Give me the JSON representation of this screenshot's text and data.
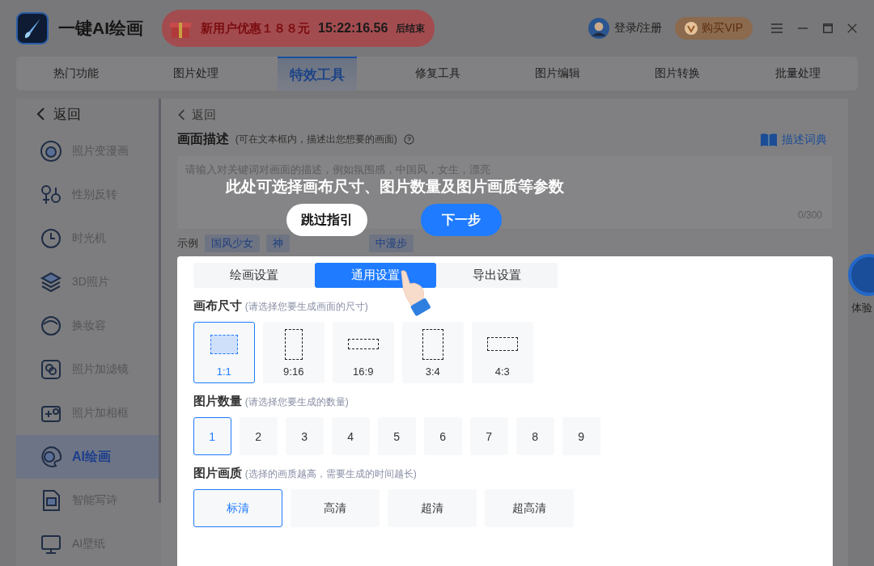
{
  "app": {
    "title": "一键AI绘画"
  },
  "promo": {
    "text": "新用户优惠１８８元",
    "countdown": "15:22:16.56",
    "suffix": "后结束"
  },
  "account": {
    "login": "登录/注册",
    "vip": "购买VIP"
  },
  "nav_tabs": [
    {
      "label": "热门功能",
      "selected": false
    },
    {
      "label": "图片处理",
      "selected": false
    },
    {
      "label": "特效工具",
      "selected": true
    },
    {
      "label": "修复工具",
      "selected": false
    },
    {
      "label": "图片编辑",
      "selected": false
    },
    {
      "label": "图片转换",
      "selected": false
    },
    {
      "label": "批量处理",
      "selected": false
    }
  ],
  "sidebar": {
    "back": "返回",
    "items": [
      {
        "label": "照片变漫画",
        "selected": false
      },
      {
        "label": "性别反转",
        "selected": false
      },
      {
        "label": "时光机",
        "selected": false
      },
      {
        "label": "3D照片",
        "selected": false
      },
      {
        "label": "换妆容",
        "selected": false
      },
      {
        "label": "照片加滤镜",
        "selected": false
      },
      {
        "label": "照片加相框",
        "selected": false
      },
      {
        "label": "AI绘画",
        "selected": true
      },
      {
        "label": "智能写诗",
        "selected": false
      },
      {
        "label": "AI壁纸",
        "selected": false
      }
    ]
  },
  "main": {
    "back": "返回",
    "description": {
      "title": "画面描述",
      "hint": "(可在文本框内，描述出您想要的画面)",
      "dictionary": "描述词典",
      "placeholder": "请输入对关键词对画面的描述，例如氛围感，中国风，女生，漂亮",
      "counter": "0/300"
    },
    "examples": {
      "label": "示例",
      "tags": [
        "国风少女",
        "神",
        "中漫步"
      ]
    }
  },
  "guide": {
    "message": "此处可选择画布尺寸、图片数量及图片画质等参数",
    "skip": "跳过指引",
    "next": "下一步"
  },
  "settings": {
    "tabs": [
      {
        "label": "绘画设置",
        "selected": false
      },
      {
        "label": "通用设置",
        "selected": true
      },
      {
        "label": "导出设置",
        "selected": false
      }
    ],
    "canvas_size": {
      "title": "画布尺寸",
      "hint": "(请选择您要生成画面的尺寸)",
      "options": [
        {
          "label": "1:1",
          "selected": true
        },
        {
          "label": "9:16",
          "selected": false
        },
        {
          "label": "16:9",
          "selected": false
        },
        {
          "label": "3:4",
          "selected": false
        },
        {
          "label": "4:3",
          "selected": false
        }
      ]
    },
    "count": {
      "title": "图片数量",
      "hint": "(请选择您要生成的数量)",
      "options": [
        {
          "label": "1",
          "selected": true
        },
        {
          "label": "2",
          "selected": false
        },
        {
          "label": "3",
          "selected": false
        },
        {
          "label": "4",
          "selected": false
        },
        {
          "label": "5",
          "selected": false
        },
        {
          "label": "6",
          "selected": false
        },
        {
          "label": "7",
          "selected": false
        },
        {
          "label": "8",
          "selected": false
        },
        {
          "label": "9",
          "selected": false
        }
      ]
    },
    "quality": {
      "title": "图片画质",
      "hint": "(选择的画质越高，需要生成的时间越长)",
      "options": [
        {
          "label": "标清",
          "selected": true
        },
        {
          "label": "高清",
          "selected": false
        },
        {
          "label": "超清",
          "selected": false
        },
        {
          "label": "超高清",
          "selected": false
        }
      ]
    }
  },
  "side_button": {
    "label": "体验"
  }
}
